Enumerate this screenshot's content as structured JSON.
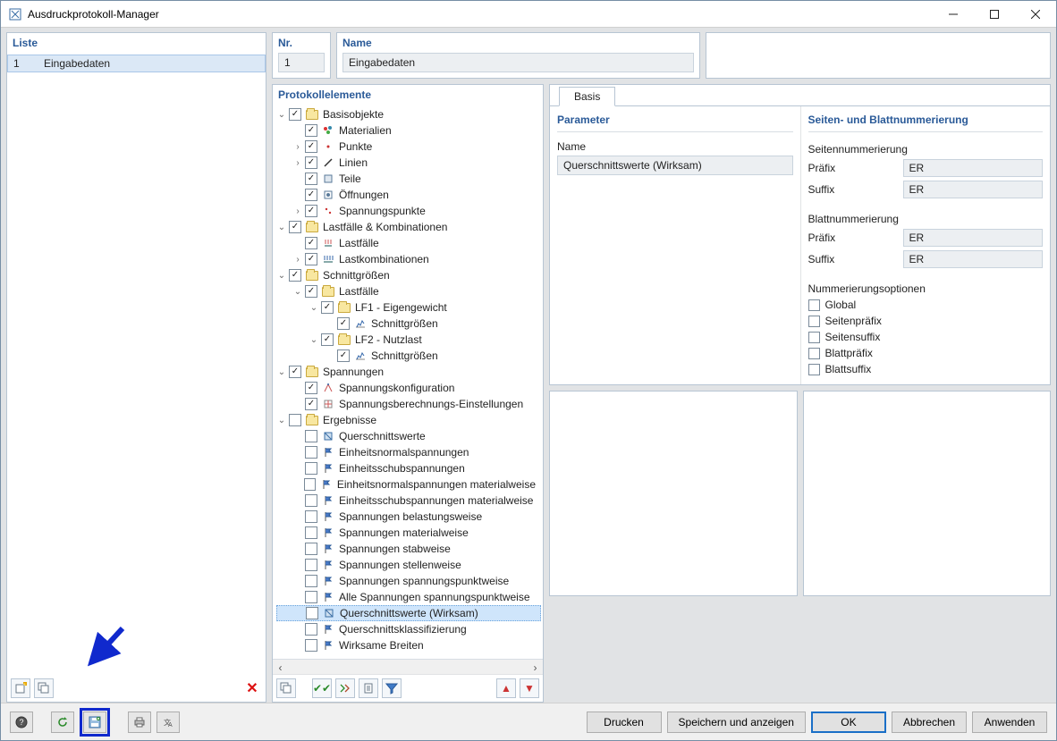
{
  "window": {
    "title": "Ausdruckprotokoll-Manager"
  },
  "left": {
    "header": "Liste",
    "rows": [
      {
        "nr": "1",
        "name": "Eingabedaten",
        "selected": true
      }
    ]
  },
  "nr": {
    "header": "Nr.",
    "value": "1"
  },
  "name": {
    "header": "Name",
    "value": "Eingabedaten"
  },
  "tree": {
    "header": "Protokollelemente",
    "items": [
      {
        "depth": 0,
        "chev": "open",
        "checked": true,
        "icon": "folder-icon",
        "label": "Basisobjekte"
      },
      {
        "depth": 1,
        "chev": "none",
        "checked": true,
        "icon": "materials-icon",
        "label": "Materialien"
      },
      {
        "depth": 1,
        "chev": "closed",
        "checked": true,
        "icon": "point-icon",
        "label": "Punkte"
      },
      {
        "depth": 1,
        "chev": "closed",
        "checked": true,
        "icon": "line-icon",
        "label": "Linien"
      },
      {
        "depth": 1,
        "chev": "none",
        "checked": true,
        "icon": "part-icon",
        "label": "Teile"
      },
      {
        "depth": 1,
        "chev": "none",
        "checked": true,
        "icon": "opening-icon",
        "label": "Öffnungen"
      },
      {
        "depth": 1,
        "chev": "closed",
        "checked": true,
        "icon": "stresspoint-icon",
        "label": "Spannungspunkte"
      },
      {
        "depth": 0,
        "chev": "open",
        "checked": true,
        "icon": "folder-icon",
        "label": "Lastfälle & Kombinationen"
      },
      {
        "depth": 1,
        "chev": "none",
        "checked": true,
        "icon": "loadcase-icon",
        "label": "Lastfälle"
      },
      {
        "depth": 1,
        "chev": "closed",
        "checked": true,
        "icon": "loadcombo-icon",
        "label": "Lastkombinationen"
      },
      {
        "depth": 0,
        "chev": "open",
        "checked": true,
        "icon": "folder-icon",
        "label": "Schnittgrößen"
      },
      {
        "depth": 1,
        "chev": "open",
        "checked": true,
        "icon": "folder-icon",
        "label": "Lastfälle"
      },
      {
        "depth": 2,
        "chev": "open",
        "checked": true,
        "icon": "folder-icon",
        "label": "LF1 - Eigengewicht"
      },
      {
        "depth": 3,
        "chev": "none",
        "checked": true,
        "icon": "internalforces-icon",
        "label": "Schnittgrößen"
      },
      {
        "depth": 2,
        "chev": "open",
        "checked": true,
        "icon": "folder-icon",
        "label": "LF2 - Nutzlast"
      },
      {
        "depth": 3,
        "chev": "none",
        "checked": true,
        "icon": "internalforces-icon",
        "label": "Schnittgrößen"
      },
      {
        "depth": 0,
        "chev": "open",
        "checked": true,
        "icon": "folder-icon",
        "label": "Spannungen"
      },
      {
        "depth": 1,
        "chev": "none",
        "checked": true,
        "icon": "stresscfg-icon",
        "label": "Spannungskonfiguration"
      },
      {
        "depth": 1,
        "chev": "none",
        "checked": true,
        "icon": "stresscalc-icon",
        "label": "Spannungsberechnungs-Einstellungen"
      },
      {
        "depth": 0,
        "chev": "open",
        "checked": false,
        "icon": "folder-icon",
        "label": "Ergebnisse"
      },
      {
        "depth": 1,
        "chev": "none",
        "checked": false,
        "icon": "crosssection-icon",
        "label": "Querschnittswerte"
      },
      {
        "depth": 1,
        "chev": "none",
        "checked": false,
        "icon": "flag-icon",
        "label": "Einheitsnormalspannungen"
      },
      {
        "depth": 1,
        "chev": "none",
        "checked": false,
        "icon": "flag-icon",
        "label": "Einheitsschubspannungen"
      },
      {
        "depth": 1,
        "chev": "none",
        "checked": false,
        "icon": "flag-icon",
        "label": "Einheitsnormalspannungen materialweise"
      },
      {
        "depth": 1,
        "chev": "none",
        "checked": false,
        "icon": "flag-icon",
        "label": "Einheitsschubspannungen materialweise"
      },
      {
        "depth": 1,
        "chev": "none",
        "checked": false,
        "icon": "flag-icon",
        "label": "Spannungen belastungsweise"
      },
      {
        "depth": 1,
        "chev": "none",
        "checked": false,
        "icon": "flag-icon",
        "label": "Spannungen materialweise"
      },
      {
        "depth": 1,
        "chev": "none",
        "checked": false,
        "icon": "flag-icon",
        "label": "Spannungen stabweise"
      },
      {
        "depth": 1,
        "chev": "none",
        "checked": false,
        "icon": "flag-icon",
        "label": "Spannungen stellenweise"
      },
      {
        "depth": 1,
        "chev": "none",
        "checked": false,
        "icon": "flag-icon",
        "label": "Spannungen spannungspunktweise"
      },
      {
        "depth": 1,
        "chev": "none",
        "checked": false,
        "icon": "flag-icon",
        "label": "Alle Spannungen spannungspunktweise"
      },
      {
        "depth": 1,
        "chev": "none",
        "checked": false,
        "icon": "crosssection-icon",
        "label": "Querschnittswerte (Wirksam)",
        "selected": true
      },
      {
        "depth": 1,
        "chev": "none",
        "checked": false,
        "icon": "flag-icon",
        "label": "Querschnittsklassifizierung"
      },
      {
        "depth": 1,
        "chev": "none",
        "checked": false,
        "icon": "flag-icon",
        "label": "Wirksame Breiten"
      }
    ]
  },
  "tab": {
    "label": "Basis"
  },
  "parameters": {
    "header": "Parameter",
    "name_label": "Name",
    "name_value": "Querschnittswerte (Wirksam)"
  },
  "numbering": {
    "header": "Seiten- und Blattnummerierung",
    "page_hdr": "Seitennummerierung",
    "page_prefix_label": "Präfix",
    "page_prefix_value": "ER",
    "page_suffix_label": "Suffix",
    "page_suffix_value": "ER",
    "sheet_hdr": "Blattnummerierung",
    "sheet_prefix_label": "Präfix",
    "sheet_prefix_value": "ER",
    "sheet_suffix_label": "Suffix",
    "sheet_suffix_value": "ER",
    "options_hdr": "Nummerierungsoptionen",
    "options": [
      "Global",
      "Seitenpräfix",
      "Seitensuffix",
      "Blattpräfix",
      "Blattsuffix"
    ]
  },
  "footer": {
    "print": "Drucken",
    "save_show": "Speichern und anzeigen",
    "ok": "OK",
    "cancel": "Abbrechen",
    "apply": "Anwenden"
  }
}
